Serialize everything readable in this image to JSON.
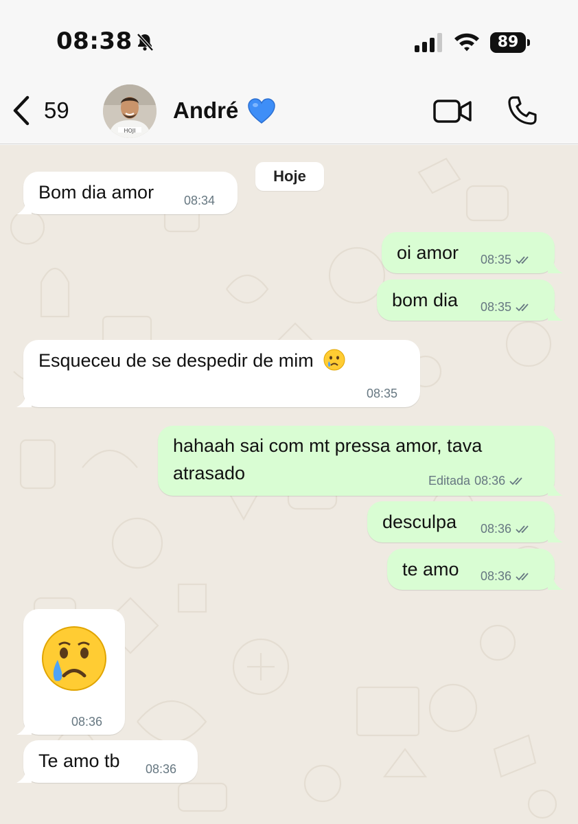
{
  "status_bar": {
    "time": "08:38",
    "battery": "89",
    "icons": [
      "bell-slash-icon",
      "signal-icon",
      "wifi-icon",
      "battery-icon"
    ]
  },
  "header": {
    "back_count": "59",
    "contact_name": "André",
    "name_emoji": "blue-heart-icon",
    "actions": [
      "video-call-icon",
      "phone-call-icon"
    ]
  },
  "chat": {
    "day_label": "Hoje",
    "messages": [
      {
        "direction": "in",
        "text": "Bom dia amor",
        "time": "08:34"
      },
      {
        "direction": "out",
        "text": "oi amor",
        "time": "08:35",
        "status": "read"
      },
      {
        "direction": "out",
        "text": "bom dia",
        "time": "08:35",
        "status": "read"
      },
      {
        "direction": "in",
        "text": "Esqueceu de se despedir de mim",
        "emoji": "crying-face-icon",
        "time": "08:35"
      },
      {
        "direction": "out",
        "text_line1": "hahaah sai com mt pressa amor, tava",
        "text_line2": "atrasado",
        "edited_label": "Editada",
        "time": "08:36",
        "status": "read"
      },
      {
        "direction": "out",
        "text": "desculpa",
        "time": "08:36",
        "status": "read"
      },
      {
        "direction": "out",
        "text": "te amo",
        "time": "08:36",
        "status": "read"
      },
      {
        "direction": "in",
        "emoji": "crying-face-icon",
        "time": "08:36"
      },
      {
        "direction": "in",
        "text": "Te amo tb",
        "time": "08:36"
      }
    ]
  },
  "colors": {
    "incoming": "#ffffff",
    "outgoing": "#d9fdd3",
    "wallpaper": "#efeae2",
    "meta": "#667781",
    "heart": "#3e8ef7"
  }
}
